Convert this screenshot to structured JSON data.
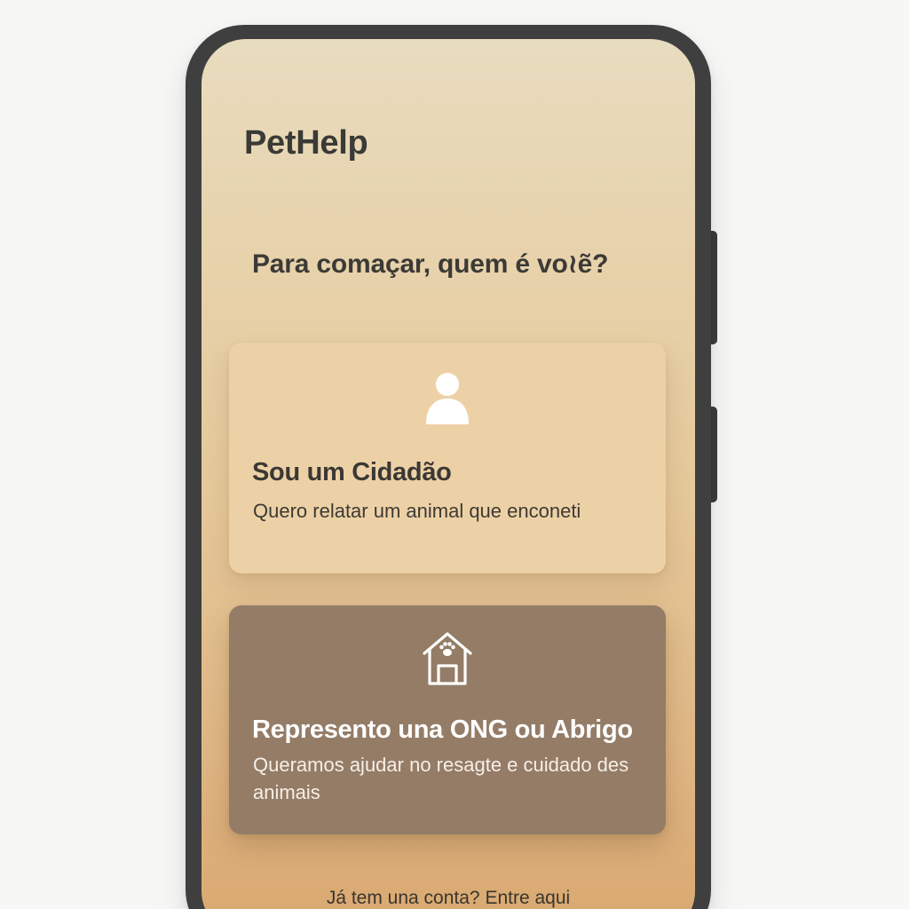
{
  "app": {
    "title": "PetHelp"
  },
  "onboarding": {
    "prompt": "Para comaçar, quem é vo≀ẽ?",
    "cards": [
      {
        "title": "Sou um Cidadão",
        "description": "Quero relatar um animal que enconeti",
        "icon": "person-icon"
      },
      {
        "title": "Represento una ONG ou Abrigo",
        "description": "Queramos ajudar no resagte e cuidado des animais",
        "icon": "doghouse-paw-icon"
      }
    ],
    "login_link": "Já tem una conta? Entre aqui"
  },
  "colors": {
    "citizen_card": "#edd1a6",
    "ngo_card": "#947c67",
    "phone_frame": "#3f3f3f"
  }
}
